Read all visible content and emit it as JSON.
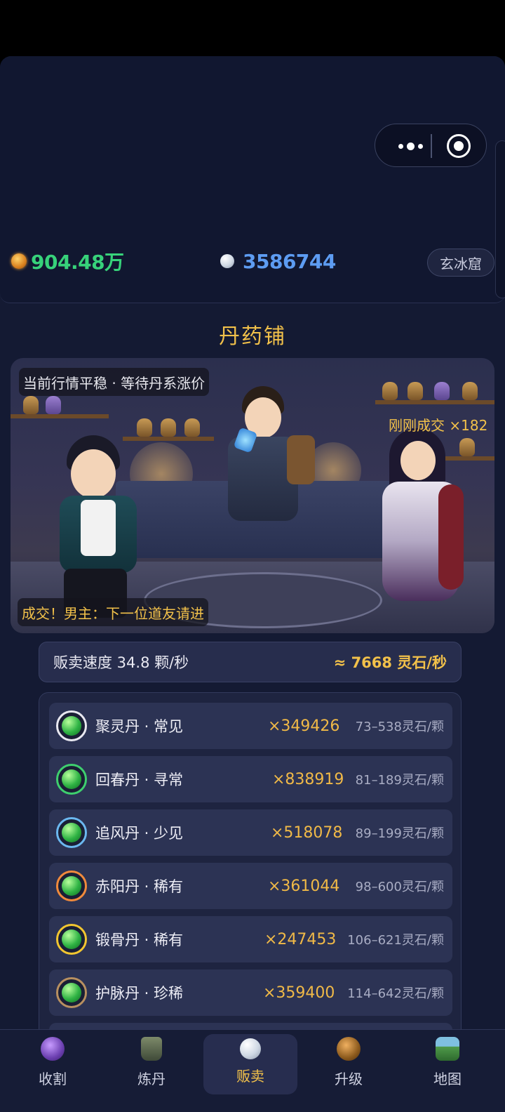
{
  "header": {
    "gold_amount": "904.48万",
    "spirit_stone_amount": "3586744",
    "location_button": "玄冰窟"
  },
  "shop": {
    "title": "丹药铺",
    "banner": {
      "market_status": "当前行情平稳 · 等待丹系涨价",
      "deal_notice": "刚刚成交 ×182",
      "dialogue": "成交！男主：下一位道友请进"
    },
    "speed": {
      "label": "贩卖速度 34.8 颗/秒",
      "income": "≈ 7668 灵石/秒"
    },
    "items": [
      {
        "name": "聚灵丹 · 常见",
        "count": "×349426",
        "price": "73–538灵石/颗",
        "ring_color": "#e8e8f0"
      },
      {
        "name": "回春丹 · 寻常",
        "count": "×838919",
        "price": "81–189灵石/颗",
        "ring_color": "#3ecf6e"
      },
      {
        "name": "追风丹 · 少见",
        "count": "×518078",
        "price": "89–199灵石/颗",
        "ring_color": "#6bb8f0"
      },
      {
        "name": "赤阳丹 · 稀有",
        "count": "×361044",
        "price": "98–600灵石/颗",
        "ring_color": "#f08a3c"
      },
      {
        "name": "锻骨丹 · 稀有",
        "count": "×247453",
        "price": "106–621灵石/颗",
        "ring_color": "#f2c630"
      },
      {
        "name": "护脉丹 · 珍稀",
        "count": "×359400",
        "price": "114–642灵石/颗",
        "ring_color": "#b89060"
      }
    ]
  },
  "nav": {
    "items": [
      {
        "label": "收割",
        "icon": "harvest-icon"
      },
      {
        "label": "炼丹",
        "icon": "cauldron-icon"
      },
      {
        "label": "贩卖",
        "icon": "pearl-icon"
      },
      {
        "label": "升级",
        "icon": "upgrade-icon"
      },
      {
        "label": "地图",
        "icon": "map-icon"
      }
    ],
    "active_index": 2
  },
  "colors": {
    "gold_text": "#37d27a",
    "stone_text": "#5d9cf2",
    "accent": "#f2c14a"
  }
}
